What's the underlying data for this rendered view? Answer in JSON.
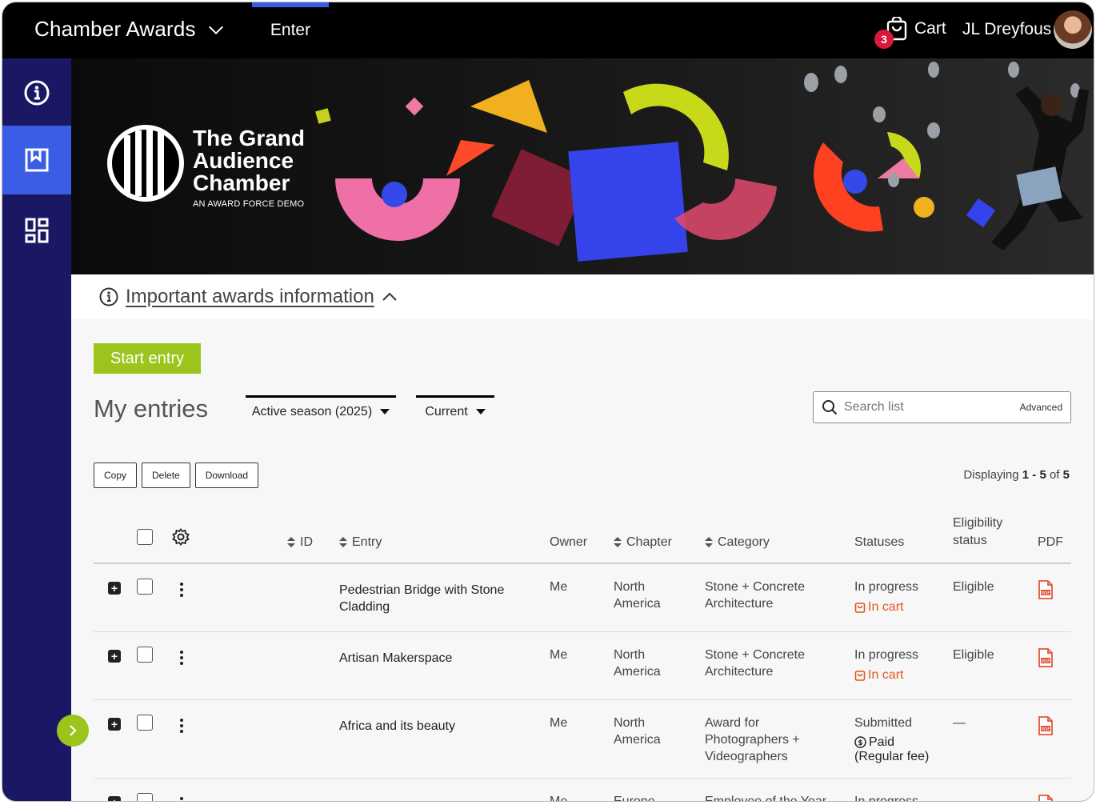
{
  "app": {
    "title": "Chamber Awards"
  },
  "nav": {
    "enter": "Enter"
  },
  "cart": {
    "label": "Cart",
    "count": "3"
  },
  "user": {
    "name": "JL Dreyfous"
  },
  "banner": {
    "logo_line1": "The Grand",
    "logo_line2": "Audience",
    "logo_line3": "Chamber",
    "logo_sub": "AN AWARD FORCE DEMO"
  },
  "info": {
    "link": "Important awards information"
  },
  "main": {
    "start_button": "Start entry",
    "heading": "My entries",
    "season_filter": "Active season (2025)",
    "status_filter": "Current",
    "search_placeholder": "Search list",
    "advanced": "Advanced",
    "copy": "Copy",
    "delete": "Delete",
    "download": "Download",
    "displaying_prefix": "Displaying",
    "displaying_range": "1 - 5",
    "displaying_of": "of",
    "displaying_total": "5"
  },
  "table": {
    "headers": {
      "id": "ID",
      "entry": "Entry",
      "owner": "Owner",
      "chapter": "Chapter",
      "category": "Category",
      "statuses": "Statuses",
      "eligibility_1": "Eligibility",
      "eligibility_2": "status",
      "pdf": "PDF"
    },
    "rows": [
      {
        "entry_1": "Pedestrian Bridge with Stone",
        "entry_2": "Cladding",
        "owner": "Me",
        "chapter_1": "North",
        "chapter_2": "America",
        "category_1": "Stone + Concrete",
        "category_2": "Architecture",
        "category_3": "",
        "status": "In progress",
        "status_sub": "In cart",
        "eligibility": "Eligible"
      },
      {
        "entry_1": "Artisan Makerspace",
        "entry_2": "",
        "owner": "Me",
        "chapter_1": "North",
        "chapter_2": "America",
        "category_1": "Stone + Concrete",
        "category_2": "Architecture",
        "category_3": "",
        "status": "In progress",
        "status_sub": "In cart",
        "eligibility": "Eligible"
      },
      {
        "entry_1": "Africa and its beauty",
        "entry_2": "",
        "owner": "Me",
        "chapter_1": "North",
        "chapter_2": "America",
        "category_1": "Award for",
        "category_2": "Photographers +",
        "category_3": "Videographers",
        "status": "Submitted",
        "status_sub": "Paid",
        "status_sub2": "(Regular fee)",
        "eligibility": "—"
      },
      {
        "entry_1": "",
        "owner": "Me",
        "chapter_1": "Europe",
        "category_1": "Employee of the Year",
        "status": "In progress"
      }
    ]
  },
  "colors": {
    "topbar": "#000000",
    "sidebar": "#1a1764",
    "accent_blue": "#3b5ce4",
    "accent_green": "#9bc51b",
    "cart_orange": "#e2561a",
    "badge_red": "#d9183b"
  }
}
